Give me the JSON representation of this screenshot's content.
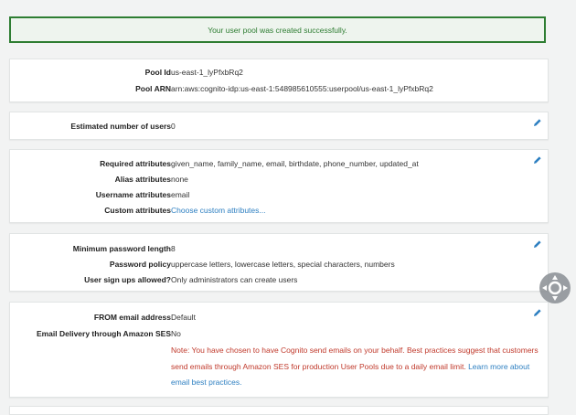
{
  "banner": {
    "message": "Your user pool was created successfully."
  },
  "pool": {
    "id_label": "Pool Id",
    "id_value": "us-east-1_lyPfxbRq2",
    "arn_label": "Pool ARN",
    "arn_value": "arn:aws:cognito-idp:us-east-1:548985610555:userpool/us-east-1_lyPfxbRq2"
  },
  "users": {
    "label": "Estimated number of users",
    "value": "0"
  },
  "attributes": {
    "required_label": "Required attributes",
    "required_value": "given_name, family_name, email, birthdate, phone_number, updated_at",
    "alias_label": "Alias attributes",
    "alias_value": "none",
    "username_label": "Username attributes",
    "username_value": "email",
    "custom_label": "Custom attributes",
    "custom_link": "Choose custom attributes..."
  },
  "password": {
    "min_label": "Minimum password length",
    "min_value": "8",
    "policy_label": "Password policy",
    "policy_value": "uppercase letters, lowercase letters, special characters, numbers",
    "signup_label": "User sign ups allowed?",
    "signup_value": "Only administrators can create users"
  },
  "email": {
    "from_label": "FROM email address",
    "from_value": "Default",
    "ses_label": "Email Delivery through Amazon SES",
    "ses_value": "No",
    "note_text": "Note: You have chosen to have Cognito send emails on your behalf. Best practices suggest that customers send emails through Amazon SES for production User Pools due to a daily email limit.",
    "note_link": "Learn more about email best practices."
  },
  "icons": {
    "edit": "pencil-icon",
    "nav": "navigation-control-icon"
  },
  "colors": {
    "success": "#2e7d32",
    "link": "#2d7fc1",
    "warning": "#c0392b"
  }
}
